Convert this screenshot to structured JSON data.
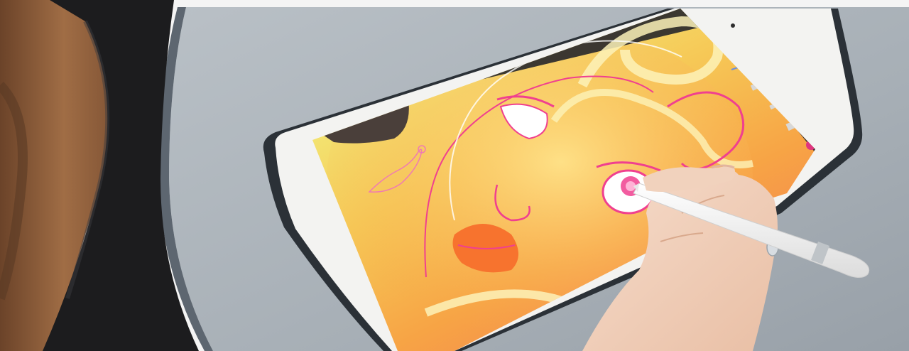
{
  "scene": {
    "subject": "photo",
    "colors": {
      "table": "#a9b1b8",
      "table_edge": "#5d6670",
      "tablet_bezel": "#f3f3f1",
      "tablet_case": "#2b3137",
      "canvas_light": "#f3f07a",
      "canvas_mid": "#f8b84a",
      "canvas_warm": "#f58a45",
      "accent_pink": "#f0408f",
      "skin": "#f1d2bd",
      "hair": "#8a5a3a",
      "sweater": "#1c1c1e"
    },
    "icons": [
      "wrench-icon",
      "magic-wand-icon",
      "selection-icon",
      "transform-icon",
      "brush-icon",
      "smudge-icon",
      "eraser-icon",
      "layers-icon",
      "color-swatch-icon"
    ]
  }
}
